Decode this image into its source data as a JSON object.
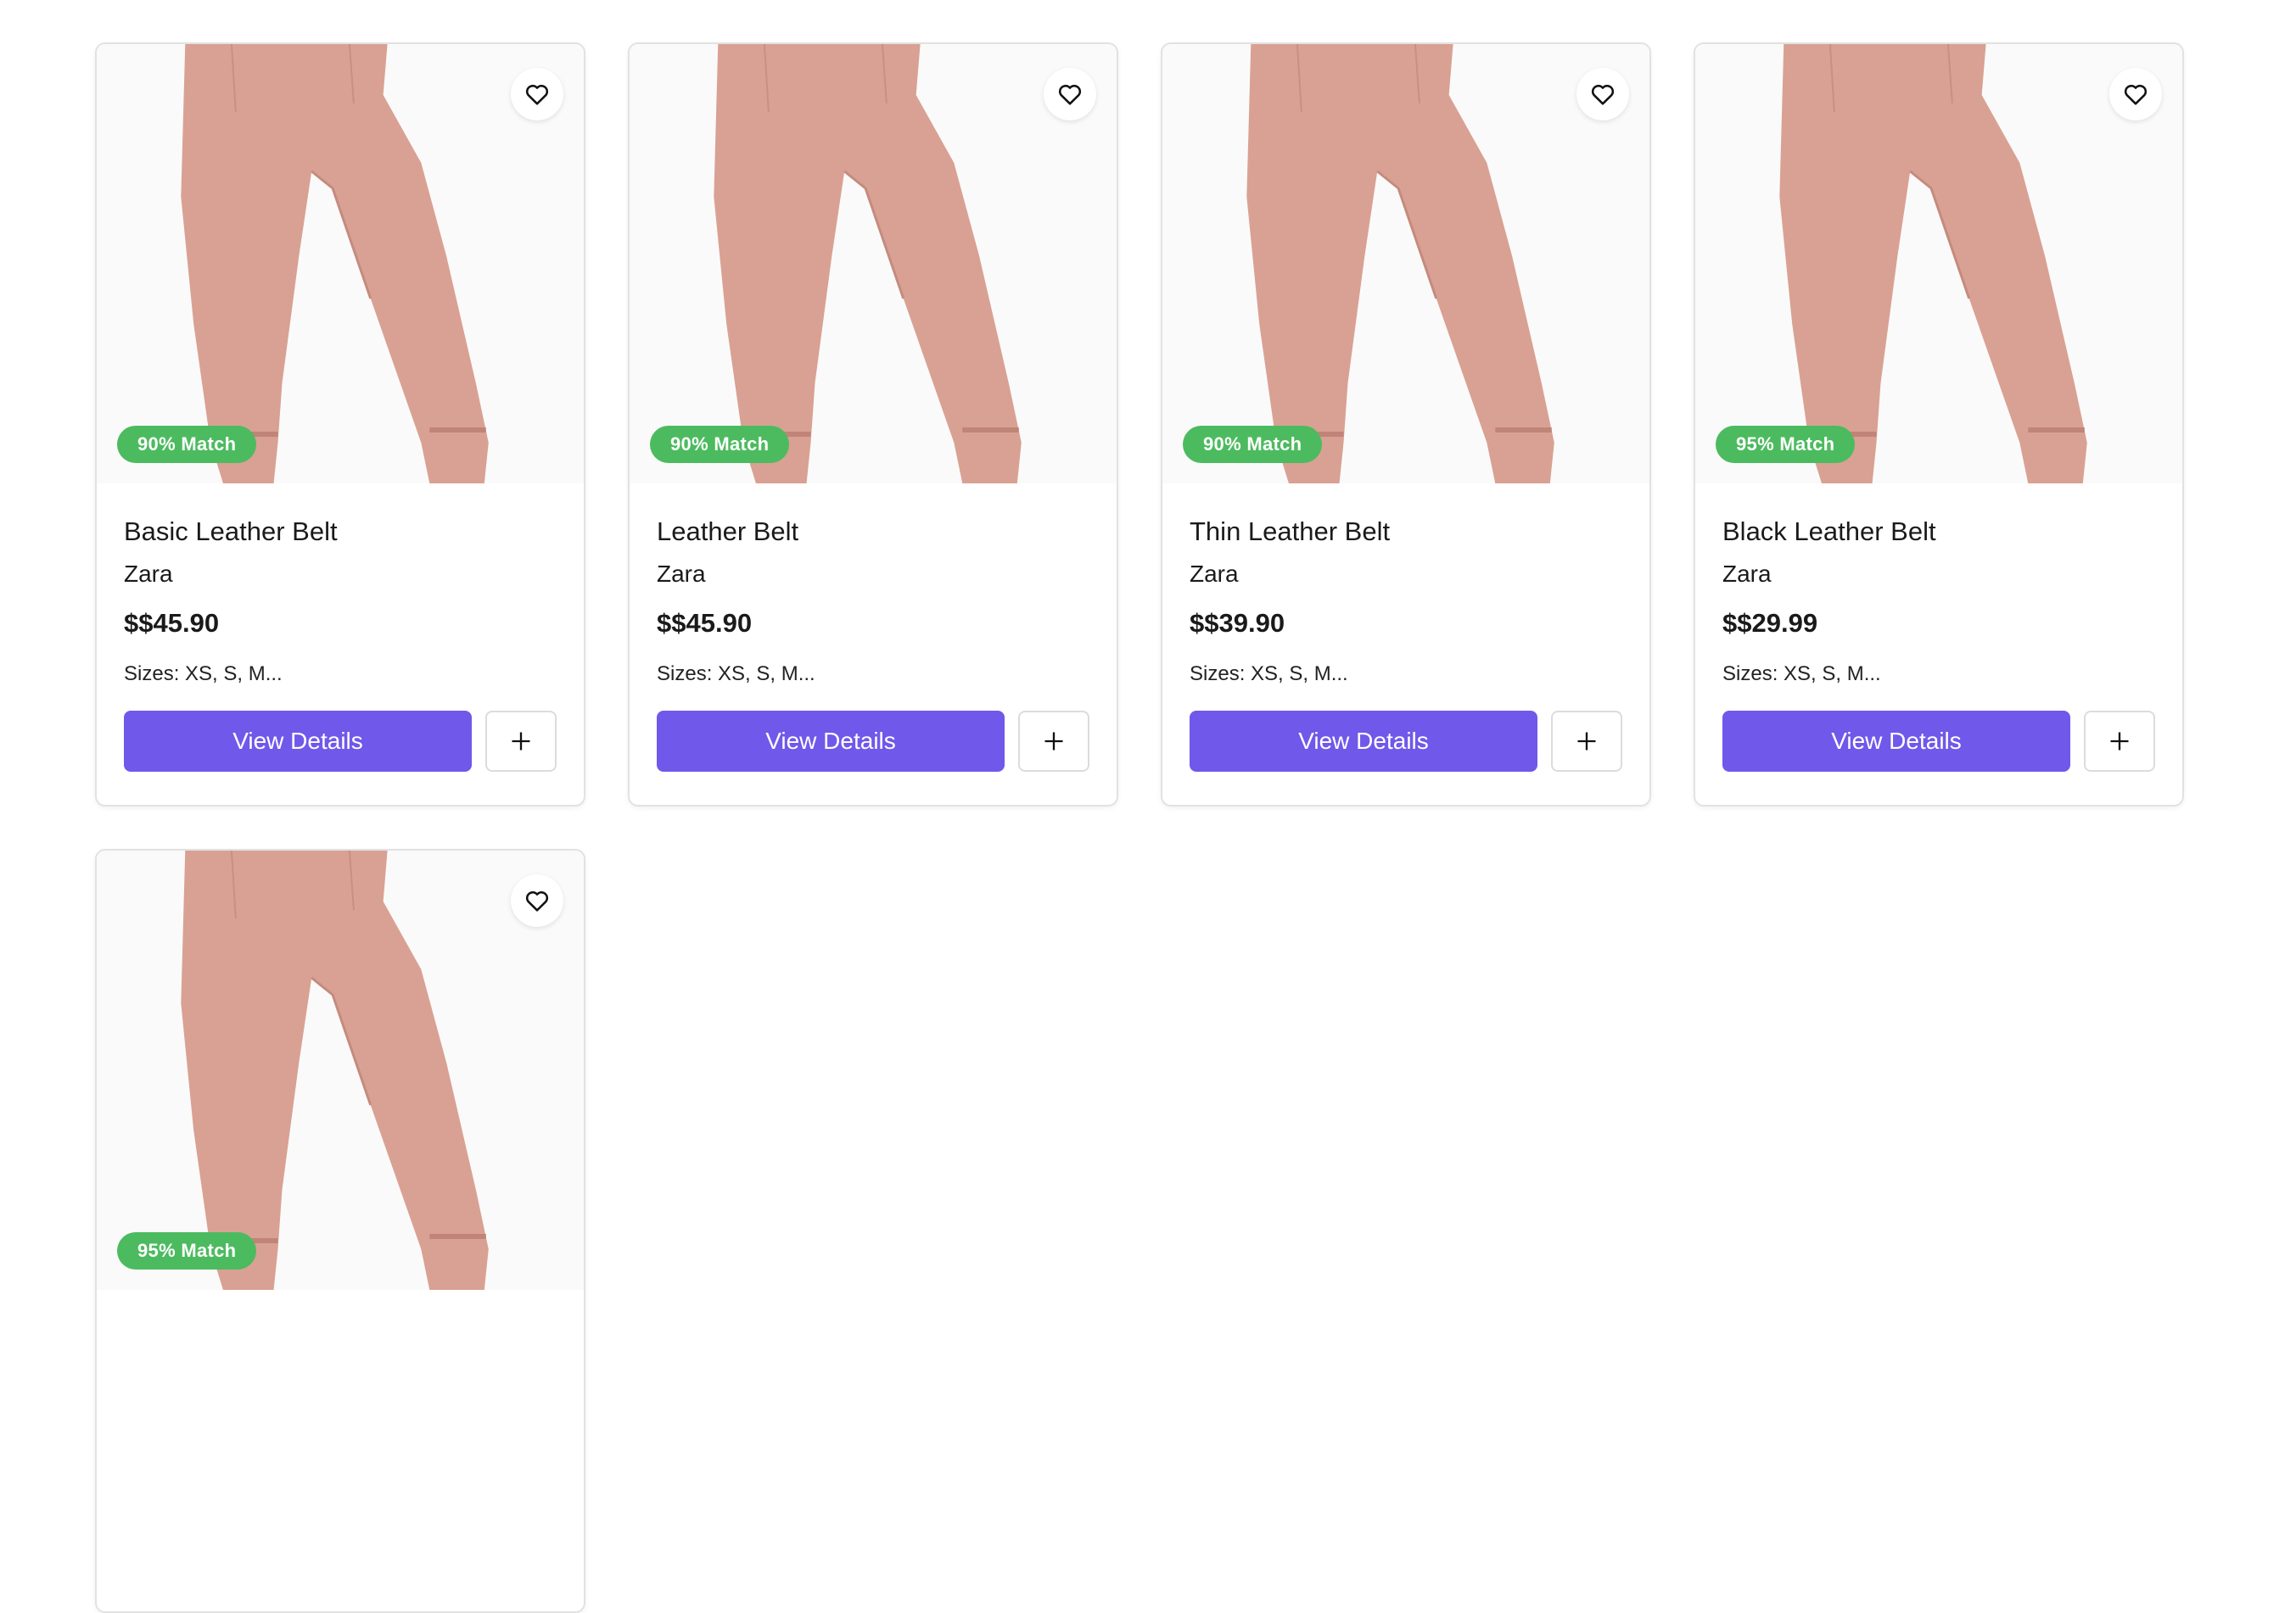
{
  "products": [
    {
      "title": "Basic Leather Belt",
      "brand": "Zara",
      "price": "$$45.90",
      "sizes": "Sizes: XS, S, M...",
      "match": "90% Match",
      "view_label": "View Details"
    },
    {
      "title": "Leather Belt",
      "brand": "Zara",
      "price": "$$45.90",
      "sizes": "Sizes: XS, S, M...",
      "match": "90% Match",
      "view_label": "View Details"
    },
    {
      "title": "Thin Leather Belt",
      "brand": "Zara",
      "price": "$$39.90",
      "sizes": "Sizes: XS, S, M...",
      "match": "90% Match",
      "view_label": "View Details"
    },
    {
      "title": "Black Leather Belt",
      "brand": "Zara",
      "price": "$$29.99",
      "sizes": "Sizes: XS, S, M...",
      "match": "95% Match",
      "view_label": "View Details"
    },
    {
      "title": "",
      "brand": "",
      "price": "",
      "sizes": "",
      "match": "95% Match",
      "view_label": ""
    }
  ],
  "icons": {
    "favorite": "heart-outline-icon",
    "add": "plus-icon"
  },
  "colors": {
    "primary_button": "#7058ea",
    "match_badge": "#4cbb5f",
    "product_fabric": "#d9a193"
  }
}
